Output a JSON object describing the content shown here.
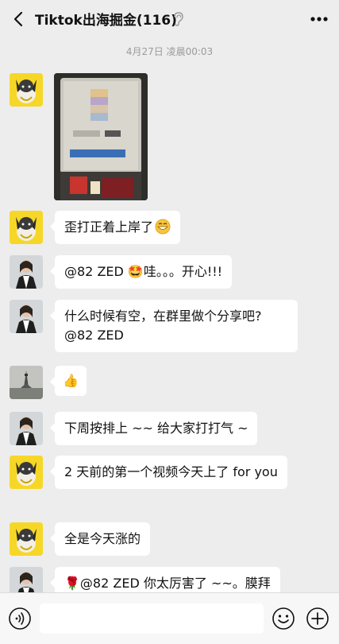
{
  "header": {
    "title": "Tiktok出海掘金(116)"
  },
  "timestamp": "4月27日 凌晨00:03",
  "messages": [
    {
      "sender": "dog",
      "type": "image"
    },
    {
      "sender": "dog",
      "text": "歪打正着上岸了"
    },
    {
      "sender": "woman",
      "text": "@82 ZED 🤩哇。。。开心!!!"
    },
    {
      "sender": "woman",
      "text": "什么时候有空，在群里做个分享吧?@82 ZED"
    },
    {
      "sender": "tower",
      "text": "👍"
    },
    {
      "sender": "woman",
      "text": "下周按排上 ~~ 给大家打打气 ~"
    },
    {
      "sender": "dog",
      "text": "2 天前的第一个视频今天上了 for you"
    },
    {
      "sender": "dog",
      "text": "全是今天涨的"
    },
    {
      "sender": "woman",
      "text": "🌹@82 ZED 你太厉害了 ~~。膜拜"
    }
  ],
  "input": {
    "value": ""
  },
  "icons": {
    "back": "chevron-left-icon",
    "ear": "ear-icon",
    "more": "more-dots-icon",
    "voice": "voice-icon",
    "emoji": "emoji-icon",
    "plus": "plus-icon"
  }
}
